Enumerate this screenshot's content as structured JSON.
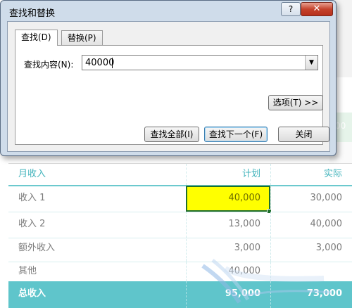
{
  "dialog": {
    "title": "查找和替换",
    "help_label": "?",
    "close_label": "✕",
    "tabs": [
      {
        "label": "查找(D)"
      },
      {
        "label": "替换(P)"
      }
    ],
    "find_label": "查找内容(N):",
    "find_value": "40000",
    "dropdown_icon": "▼",
    "options_label": "选项(T) >>",
    "find_all_label": "查找全部(I)",
    "find_next_label": "查找下一个(F)",
    "close_button_label": "关闭"
  },
  "sheet": {
    "header": {
      "col1": "月收入",
      "col2": "计划",
      "col3": "实际"
    },
    "rows": [
      {
        "label": "收入 1",
        "plan": "40,000",
        "actual": "30,000"
      },
      {
        "label": "收入 2",
        "plan": "13,000",
        "actual": "40,000"
      },
      {
        "label": "额外收入",
        "plan": "3,000",
        "actual": "3,000"
      },
      {
        "label": "其他",
        "plan": "40,000",
        "actual": ""
      }
    ],
    "total": {
      "label": "总收入",
      "plan": "95,000",
      "actual": "73,000"
    },
    "partial_right_text": "00",
    "accent_color": "#5fc5cb",
    "highlight_color": "#ffff00"
  }
}
